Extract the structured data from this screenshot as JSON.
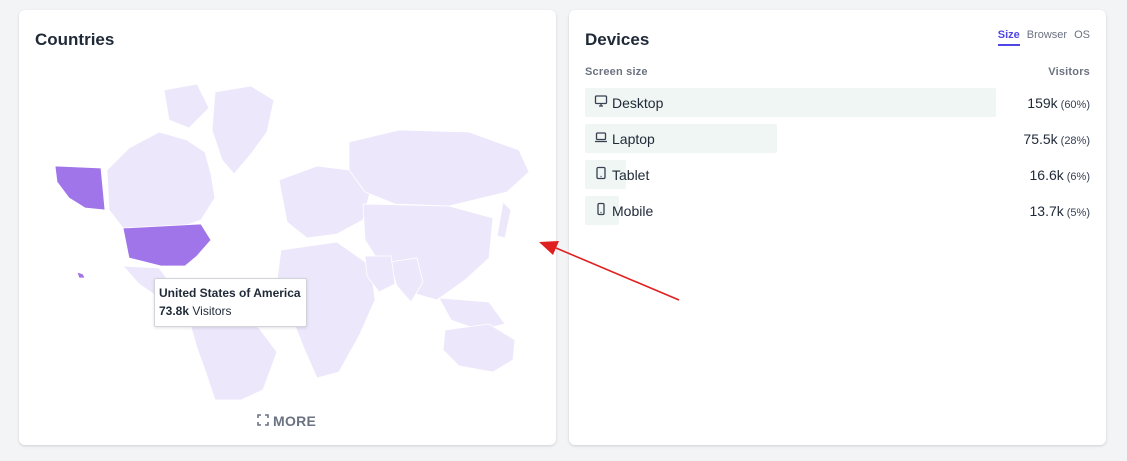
{
  "countries": {
    "title": "Countries",
    "tooltip": {
      "country": "United States of America",
      "value": "73.8k",
      "label": "Visitors"
    },
    "more_label": "MORE",
    "highlight_color": "#a175ea",
    "base_color": "#ede7fb"
  },
  "devices": {
    "title": "Devices",
    "tabs": [
      {
        "label": "Size",
        "active": true
      },
      {
        "label": "Browser",
        "active": false
      },
      {
        "label": "OS",
        "active": false
      }
    ],
    "col_left": "Screen size",
    "col_right": "Visitors",
    "rows": [
      {
        "label": "Desktop",
        "icon": "monitor-icon",
        "value": "159k",
        "pct": "(60%)",
        "share": 0.6
      },
      {
        "label": "Laptop",
        "icon": "laptop-icon",
        "value": "75.5k",
        "pct": "(28%)",
        "share": 0.28
      },
      {
        "label": "Tablet",
        "icon": "tablet-icon",
        "value": "16.6k",
        "pct": "(6%)",
        "share": 0.06
      },
      {
        "label": "Mobile",
        "icon": "mobile-icon",
        "value": "13.7k",
        "pct": "(5%)",
        "share": 0.05
      }
    ],
    "bar_color": "#f0f6f3"
  },
  "annotation": {
    "arrow_color": "#e02020"
  }
}
